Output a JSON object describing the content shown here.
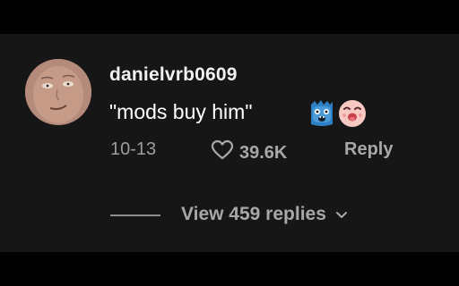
{
  "comment": {
    "username": "danielvrb0609",
    "text": "\"mods buy him\"",
    "emojis": [
      "shocked-blue-monster-emoji",
      "crying-pink-face-emoji"
    ],
    "date": "10-13",
    "like_count": "39.6K",
    "reply_label": "Reply",
    "view_replies_label": "View 459 replies"
  },
  "icons": {
    "like": "heart-outline-icon",
    "expand": "chevron-down-icon"
  },
  "colors": {
    "background": "#161616",
    "text_primary": "#f1f1f1",
    "text_secondary": "#a8a8a8"
  }
}
